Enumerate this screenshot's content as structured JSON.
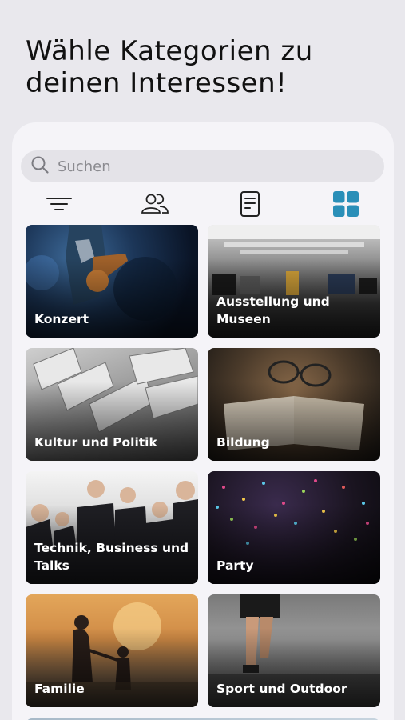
{
  "header": {
    "title_line1": "Wähle Kategorien zu",
    "title_line2": "deinen Interessen!"
  },
  "search": {
    "placeholder": "Suchen",
    "icon": "search-icon"
  },
  "tabs": [
    {
      "icon": "filter-icon",
      "active": false
    },
    {
      "icon": "people-icon",
      "active": false
    },
    {
      "icon": "document-icon",
      "active": false
    },
    {
      "icon": "grid-icon",
      "active": true
    }
  ],
  "colors": {
    "accent": "#2a8fb8",
    "background": "#e9e8ed",
    "sheet": "#f5f4f8",
    "search_bg": "#e4e3e8"
  },
  "categories": [
    {
      "label": "Konzert"
    },
    {
      "label": "Ausstellung und Museen"
    },
    {
      "label": "Kultur und Politik"
    },
    {
      "label": "Bildung"
    },
    {
      "label": "Technik, Business und Talks"
    },
    {
      "label": "Party"
    },
    {
      "label": "Familie"
    },
    {
      "label": "Sport und Outdoor"
    }
  ]
}
